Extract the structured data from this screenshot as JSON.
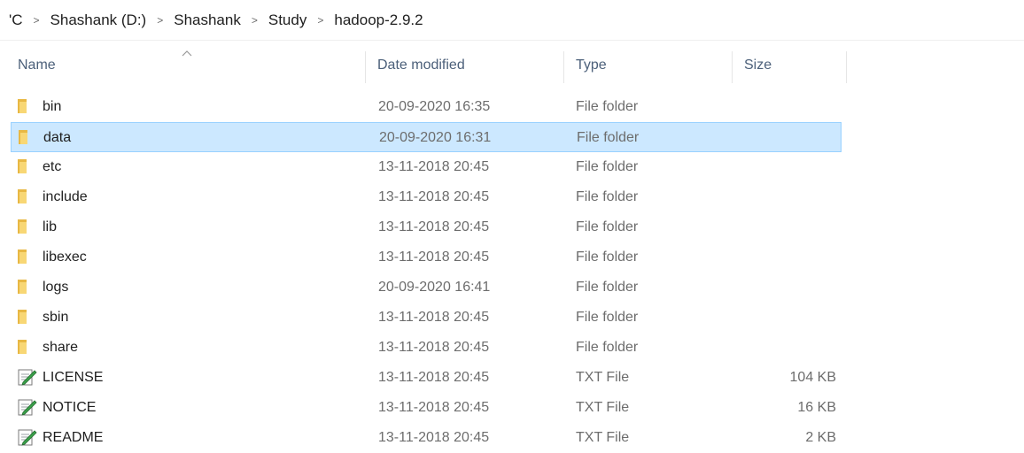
{
  "breadcrumb": {
    "items": [
      "'C",
      "Shashank (D:)",
      "Shashank",
      "Study",
      "hadoop-2.9.2"
    ],
    "separator": ">"
  },
  "columns": {
    "name": "Name",
    "date": "Date modified",
    "type": "Type",
    "size": "Size"
  },
  "files": [
    {
      "name": "bin",
      "date": "20-09-2020 16:35",
      "type": "File folder",
      "size": "",
      "icon": "folder-icon"
    },
    {
      "name": "data",
      "date": "20-09-2020 16:31",
      "type": "File folder",
      "size": "",
      "icon": "folder-icon",
      "selected": true
    },
    {
      "name": "etc",
      "date": "13-11-2018 20:45",
      "type": "File folder",
      "size": "",
      "icon": "folder-icon"
    },
    {
      "name": "include",
      "date": "13-11-2018 20:45",
      "type": "File folder",
      "size": "",
      "icon": "folder-icon"
    },
    {
      "name": "lib",
      "date": "13-11-2018 20:45",
      "type": "File folder",
      "size": "",
      "icon": "folder-icon"
    },
    {
      "name": "libexec",
      "date": "13-11-2018 20:45",
      "type": "File folder",
      "size": "",
      "icon": "folder-icon"
    },
    {
      "name": "logs",
      "date": "20-09-2020 16:41",
      "type": "File folder",
      "size": "",
      "icon": "folder-icon"
    },
    {
      "name": "sbin",
      "date": "13-11-2018 20:45",
      "type": "File folder",
      "size": "",
      "icon": "folder-icon"
    },
    {
      "name": "share",
      "date": "13-11-2018 20:45",
      "type": "File folder",
      "size": "",
      "icon": "folder-icon"
    },
    {
      "name": "LICENSE",
      "date": "13-11-2018 20:45",
      "type": "TXT File",
      "size": "104 KB",
      "icon": "txt-file-icon"
    },
    {
      "name": "NOTICE",
      "date": "13-11-2018 20:45",
      "type": "TXT File",
      "size": "16 KB",
      "icon": "txt-file-icon"
    },
    {
      "name": "README",
      "date": "13-11-2018 20:45",
      "type": "TXT File",
      "size": "2 KB",
      "icon": "txt-file-icon"
    }
  ],
  "colors": {
    "selection_bg": "#cce8ff",
    "selection_border": "#99d1ff",
    "folder": "#f8d775",
    "header_text": "#4c607a"
  }
}
